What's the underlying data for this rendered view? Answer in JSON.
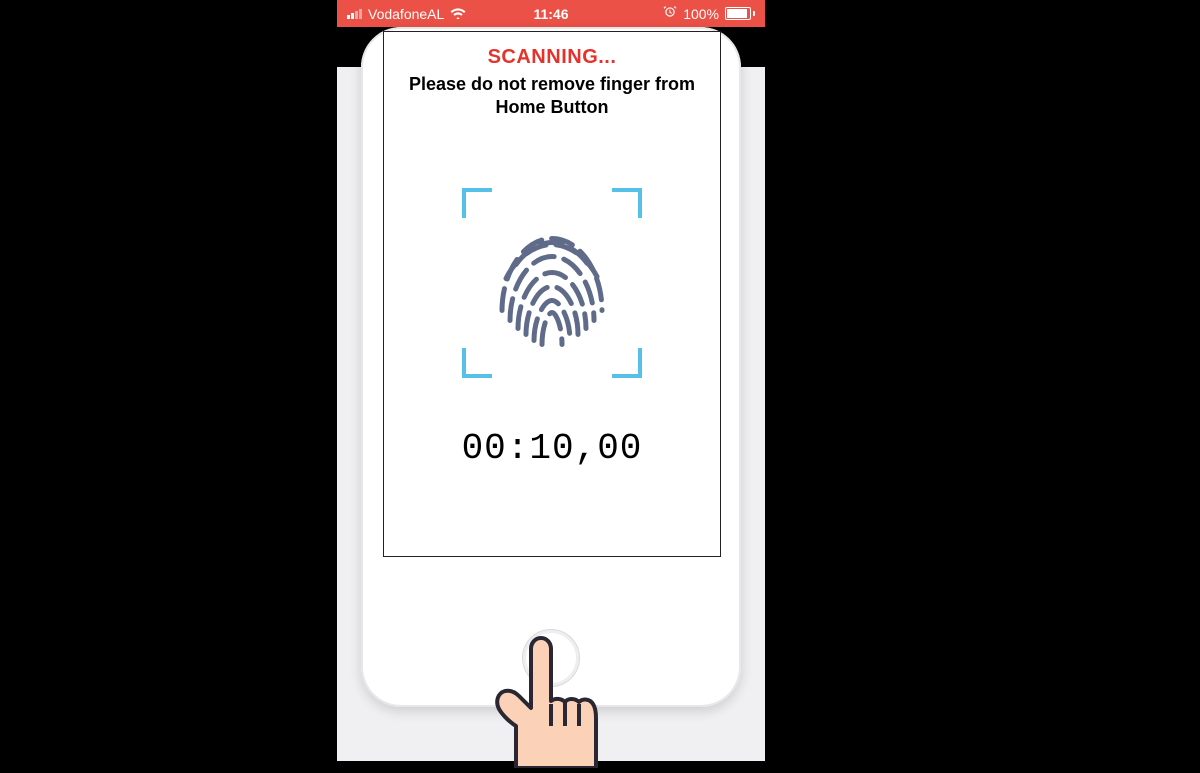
{
  "statusbar": {
    "carrier": "VodafoneAL",
    "time": "11:46",
    "battery_percent": "100%"
  },
  "nav": {
    "title": "Scanning..."
  },
  "screen": {
    "title": "SCANNING...",
    "instruction": "Please do not remove finger from Home Button",
    "timer": "00:10,00"
  },
  "colors": {
    "status_bg": "#eb5146",
    "accent_red": "#e5332b",
    "scan_frame": "#56c0e8",
    "fingerprint": "#5f6b88",
    "hand_fill": "#fbd1b8",
    "hand_stroke": "#2a2732"
  },
  "icons": {
    "signal": "signal-bars-icon",
    "wifi": "wifi-icon",
    "alarm": "alarm-icon",
    "battery": "battery-icon",
    "fingerprint": "fingerprint-icon",
    "home": "home-button-icon",
    "hand": "pointing-hand-icon"
  }
}
